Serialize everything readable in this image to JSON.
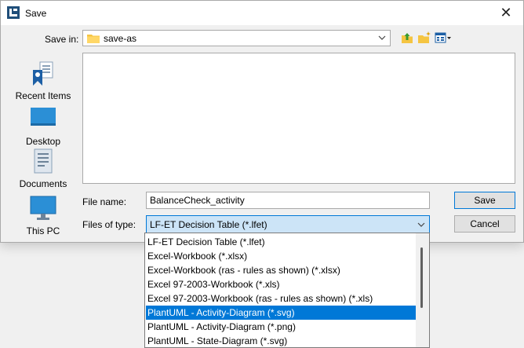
{
  "window": {
    "title": "Save",
    "close_glyph": "✕"
  },
  "save_in": {
    "label": "Save in:",
    "value": "save-as"
  },
  "toolbar": {
    "icons": [
      "up-folder-icon",
      "new-folder-icon",
      "view-menu-icon"
    ]
  },
  "places": [
    {
      "label": "Recent Items",
      "icon": "recent-items-icon"
    },
    {
      "label": "Desktop",
      "icon": "desktop-icon"
    },
    {
      "label": "Documents",
      "icon": "documents-icon"
    },
    {
      "label": "This PC",
      "icon": "this-pc-icon"
    }
  ],
  "file_name": {
    "label": "File name:",
    "value": "BalanceCheck_activity"
  },
  "file_type": {
    "label": "Files of type:",
    "value": "LF-ET Decision Table (*.lfet)",
    "options": [
      "LF-ET Decision Table (*.lfet)",
      "Excel-Workbook (*.xlsx)",
      "Excel-Workbook (ras - rules as shown) (*.xlsx)",
      "Excel 97-2003-Workbook (*.xls)",
      "Excel 97-2003-Workbook (ras - rules as shown) (*.xls)",
      "PlantUML - Activity-Diagram (*.svg)",
      "PlantUML - Activity-Diagram (*.png)",
      "PlantUML - State-Diagram (*.svg)"
    ],
    "highlighted_option": "PlantUML - Activity-Diagram (*.svg)"
  },
  "buttons": {
    "save": "Save",
    "cancel": "Cancel"
  },
  "colors": {
    "accent": "#0078d7",
    "selection_bg": "#cce4f7",
    "dialog_bg": "#f0f0f0"
  }
}
